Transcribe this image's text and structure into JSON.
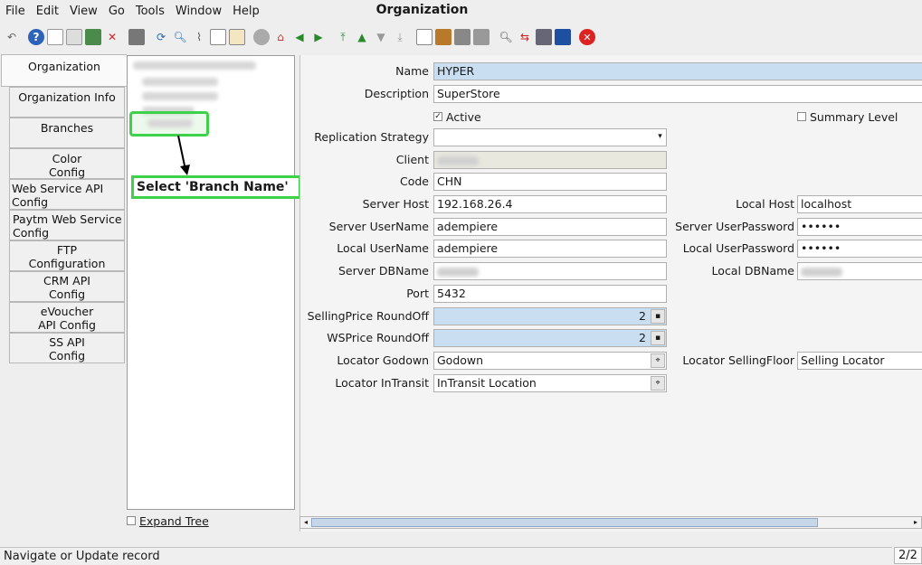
{
  "window": {
    "title": "Organization"
  },
  "menu": [
    "File",
    "Edit",
    "View",
    "Go",
    "Tools",
    "Window",
    "Help"
  ],
  "toolbar_icons": [
    "undo-icon",
    "help-icon",
    "new-record-icon",
    "copy-record-icon",
    "save-icon",
    "delete-icon",
    "print-preview-icon",
    "refresh-icon",
    "find-icon",
    "attachment-icon",
    "chat-icon",
    "history-icon",
    "home-icon",
    "house-icon",
    "previous-icon",
    "next-icon",
    "first-record-icon",
    "previous-record-icon",
    "next-record-icon",
    "last-record-icon",
    "report-icon",
    "archive-icon",
    "print-icon",
    "print-alt-icon",
    "zoom-across-icon",
    "workflow-icon",
    "product-info-icon",
    "exit-icon",
    "close-window-icon"
  ],
  "tabs": [
    {
      "label": "Organization"
    },
    {
      "label": "Organization Info"
    },
    {
      "label": "Branches"
    },
    {
      "label": "Color Config"
    },
    {
      "label": "Web Service API Config"
    },
    {
      "label": "Paytm Web Service Config"
    },
    {
      "label": "FTP Configuration"
    },
    {
      "label": "CRM API Config"
    },
    {
      "label": "eVoucher API Config"
    },
    {
      "label": "SS API Config"
    }
  ],
  "tree": {
    "expand_label": "Expand Tree"
  },
  "callout": {
    "text": "Select 'Branch Name'"
  },
  "form": {
    "name": {
      "label": "Name",
      "value": "HYPER"
    },
    "description": {
      "label": "Description",
      "value": "SuperStore"
    },
    "active": {
      "label": "Active",
      "checked": true
    },
    "summary_level": {
      "label": "Summary Level",
      "checked": false
    },
    "replication_strategy": {
      "label": "Replication Strategy",
      "value": ""
    },
    "client": {
      "label": "Client"
    },
    "code": {
      "label": "Code",
      "value": "CHN"
    },
    "server_host": {
      "label": "Server Host",
      "value": "192.168.26.4"
    },
    "local_host": {
      "label": "Local Host",
      "value": "localhost"
    },
    "server_username": {
      "label": "Server UserName",
      "value": "adempiere"
    },
    "server_password": {
      "label": "Server UserPassword",
      "value": "••••••"
    },
    "local_username": {
      "label": "Local UserName",
      "value": "adempiere"
    },
    "local_password": {
      "label": "Local UserPassword",
      "value": "••••••"
    },
    "server_dbname": {
      "label": "Server DBName"
    },
    "local_dbname": {
      "label": "Local DBName"
    },
    "port": {
      "label": "Port",
      "value": "5432"
    },
    "selling_price_roundoff": {
      "label": "SellingPrice RoundOff",
      "value": "2"
    },
    "ws_price_roundoff": {
      "label": "WSPrice RoundOff",
      "value": "2"
    },
    "locator_godown": {
      "label": "Locator Godown",
      "value": "Godown"
    },
    "locator_selling_floor": {
      "label": "Locator SellingFloor",
      "value": "Selling Locator"
    },
    "locator_intransit": {
      "label": "Locator InTransit",
      "value": "InTransit Location"
    }
  },
  "status": {
    "text": "Navigate or Update record",
    "page": "2/2"
  }
}
